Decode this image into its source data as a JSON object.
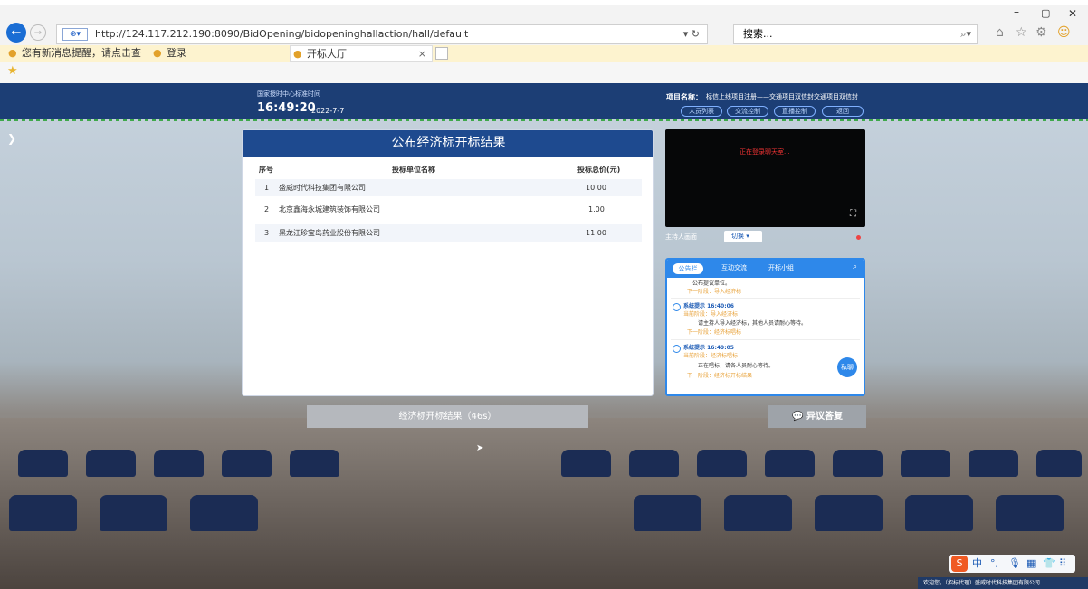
{
  "browser": {
    "url": "http://124.117.212.190:8090/BidOpening/bidopeninghallaction/hall/default",
    "search_placeholder": "搜索...",
    "tabs": [
      {
        "label": "您有新消息提醒，请点击查看！"
      },
      {
        "label": "登录"
      },
      {
        "label": "开标大厅"
      }
    ]
  },
  "header": {
    "time_label": "国家授时中心标准时间",
    "time": "16:49:20",
    "date": "2022-7-7",
    "project_label": "项目名称：",
    "project_name": "标信上线项目注册——交通项目双信封交通项目双信封",
    "buttons": [
      "人员列表",
      "交流控制",
      "直播控制",
      "返回"
    ]
  },
  "result_panel": {
    "title": "公布经济标开标结果",
    "columns": [
      "序号",
      "投标单位名称",
      "投标总价(元)"
    ],
    "rows": [
      {
        "no": "1",
        "name": "盛威时代科技集团有限公司",
        "price": "10.00"
      },
      {
        "no": "2",
        "name": "北京鑫海永城建筑装饰有限公司",
        "price": "1.00"
      },
      {
        "no": "3",
        "name": "黑龙江珍宝岛药业股份有限公司",
        "price": "11.00"
      }
    ]
  },
  "video": {
    "status": "正在登录聊天室...",
    "host_label": "主持人画面",
    "switch_label": "切换"
  },
  "chat": {
    "tabs": [
      "公告栏",
      "互动交流",
      "开标小组"
    ],
    "messages": [
      {
        "text1": "公布提议单位。",
        "next": "下一阶段：导入经济标"
      },
      {
        "title": "系统提示 16:40:06",
        "stage": "当前阶段：导入经济标",
        "text1": "请主持人导入经济标，其他人员请耐心等待。",
        "next": "下一阶段：经济标唱标"
      },
      {
        "title": "系统提示 16:49:05",
        "stage": "当前阶段：经济标唱标",
        "text1": "正在唱标，请各人员耐心等待。",
        "next": "下一阶段：经济标开标结果"
      }
    ],
    "private_label": "私聊"
  },
  "bottom": {
    "result_button": "经济标开标结果（46s）",
    "objection_button": "异议答复",
    "welcome": "欢迎您，（招标代理）盛威时代科技集团有限公司"
  }
}
